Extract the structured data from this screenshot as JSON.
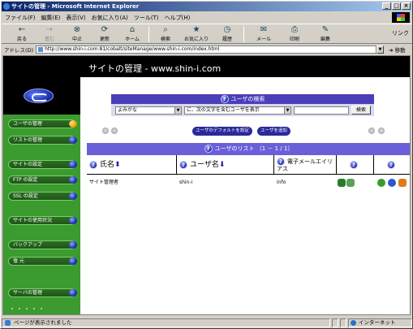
{
  "window": {
    "title": "サイトの管理 - Microsoft Internet Explorer",
    "controls": [
      "_",
      "□",
      "×"
    ]
  },
  "menu": [
    "ファイル(F)",
    "編集(E)",
    "表示(V)",
    "お気に入り(A)",
    "ツール(T)",
    "ヘルプ(H)"
  ],
  "toolbar": {
    "back": "戻る",
    "forward": "進む",
    "stop": "中止",
    "refresh": "更新",
    "home": "ホーム",
    "search": "検索",
    "favorites": "お気に入り",
    "history": "履歴",
    "mail": "メール",
    "print": "印刷",
    "edit": "編集",
    "links": "リンク"
  },
  "address": {
    "label": "アドレス(D)",
    "url": "http://www.shin-i.com:81/cobalt/siteManage/www.shin-i.com/index.html",
    "go": "移動"
  },
  "header": {
    "title": "サイトの管理 - www.shin-i.com"
  },
  "sidebar": {
    "items": [
      {
        "label": "ユーザの管理",
        "active": true
      },
      {
        "label": "リストの管理",
        "active": false
      },
      {
        "label": "サイトの設定",
        "active": false
      },
      {
        "label": "FTP の設定",
        "active": false
      },
      {
        "label": "SSL の設定",
        "active": false
      },
      {
        "label": "サイトの使用状況",
        "active": false
      },
      {
        "label": "バックアップ",
        "active": false
      },
      {
        "label": "復 元",
        "active": false
      },
      {
        "label": "サーバの管理",
        "active": false
      }
    ]
  },
  "search": {
    "title": "ユーザの検索",
    "field_select": "よみがな",
    "mode_select": "に、次の文字を含むユーザを表示",
    "query_value": "",
    "button": "検索"
  },
  "actions": {
    "set_default": "ユーザのデフォルトを設定",
    "add_user": "ユーザを追加"
  },
  "list": {
    "title": "ユーザのリスト （1 － 1 / 1）",
    "columns": {
      "name": "氏名",
      "username": "ユーザ名",
      "email_alias": "電子メールエイリアス"
    },
    "rows": [
      {
        "name": "サイト管理者",
        "username": "shin-i",
        "email_alias": "info"
      }
    ]
  },
  "status": {
    "message": "ページが表示されました",
    "zone": "インターネット"
  },
  "colors": {
    "sidebar": "#3b9b2f",
    "header": "#4a3fb8",
    "list_header": "#6a5fd8",
    "pill": "#2a2a9a"
  }
}
